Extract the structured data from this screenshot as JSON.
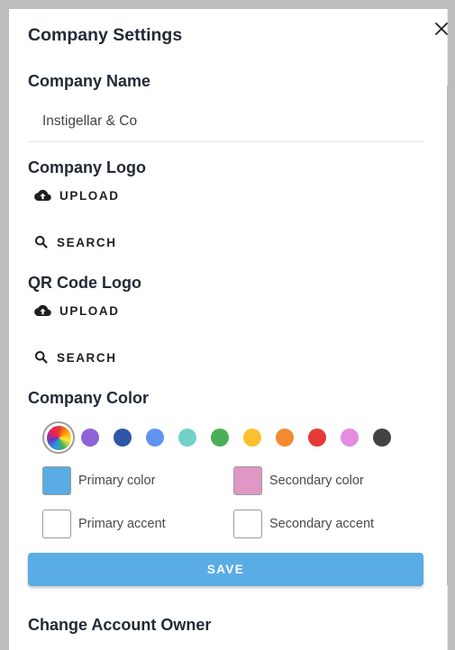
{
  "dialog": {
    "title": "Company Settings"
  },
  "company_name": {
    "label": "Company Name",
    "value": "Instigellar & Co"
  },
  "company_logo": {
    "label": "Company Logo",
    "upload_label": "UPLOAD",
    "search_label": "SEARCH"
  },
  "qr_logo": {
    "label": "QR Code Logo",
    "upload_label": "UPLOAD",
    "search_label": "SEARCH"
  },
  "company_color": {
    "label": "Company Color",
    "palette": [
      "#8e63d8",
      "#2f56a8",
      "#5f93f0",
      "#72d1c9",
      "#4caf58",
      "#fbc02d",
      "#f28b30",
      "#e53935",
      "#e58be0",
      "#434343"
    ],
    "primary_color": {
      "label": "Primary color",
      "color": "#5aace5"
    },
    "secondary_color": {
      "label": "Secondary color",
      "color": "#de98c3"
    },
    "primary_accent": {
      "label": "Primary accent",
      "color": "#ffffff"
    },
    "secondary_accent": {
      "label": "Secondary accent",
      "color": "#ffffff"
    }
  },
  "save_label": "SAVE",
  "change_owner": {
    "label": "Change Account Owner"
  }
}
